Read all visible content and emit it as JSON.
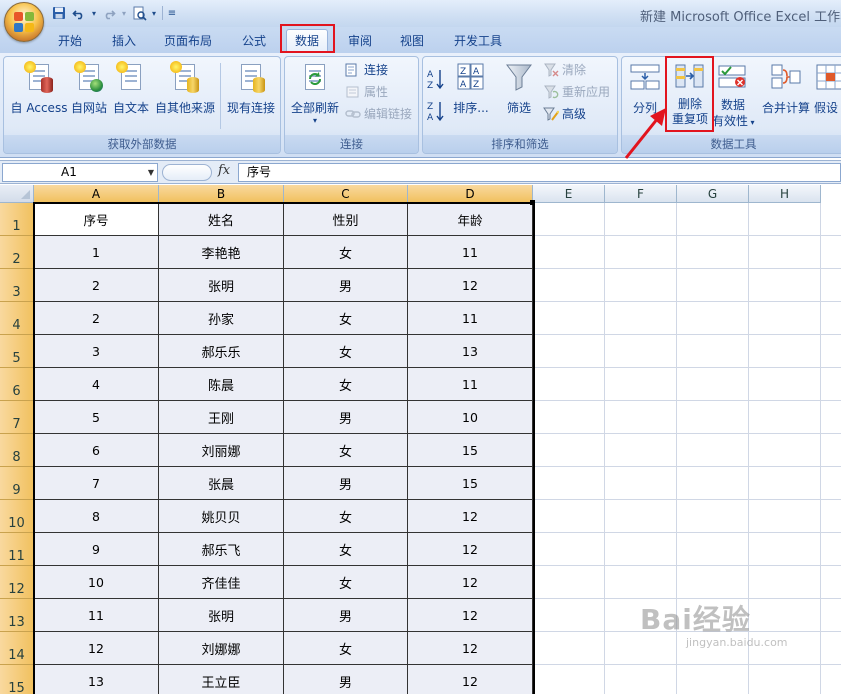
{
  "window": {
    "title": "新建 Microsoft Office Excel 工作表.x"
  },
  "quick_access": {
    "icons": [
      "save-icon",
      "undo-icon",
      "redo-icon",
      "print-preview-icon",
      "customize-qat-icon"
    ]
  },
  "tabs": [
    {
      "label": "开始"
    },
    {
      "label": "插入"
    },
    {
      "label": "页面布局"
    },
    {
      "label": "公式"
    },
    {
      "label": "数据",
      "active": true
    },
    {
      "label": "审阅"
    },
    {
      "label": "视图"
    },
    {
      "label": "开发工具"
    }
  ],
  "ribbon": {
    "external": {
      "label": "获取外部数据",
      "access": "自 Access",
      "web": "自网站",
      "text": "自文本",
      "other": "自其他来源",
      "existing": "现有连接"
    },
    "connections": {
      "label": "连接",
      "refresh_all": "全部刷新",
      "connections": "连接",
      "properties": "属性",
      "edit_links": "编辑链接"
    },
    "sort_filter": {
      "label": "排序和筛选",
      "sort": "排序...",
      "filter": "筛选",
      "clear": "清除",
      "reapply": "重新应用",
      "advanced": "高级"
    },
    "data_tools": {
      "label": "数据工具",
      "split": "分列",
      "remove_dup_1": "删除",
      "remove_dup_2": "重复项",
      "validation_1": "数据",
      "validation_2": "有效性",
      "consolidate": "合并计算",
      "whatif": "假设"
    }
  },
  "formula_bar": {
    "cell_ref": "A1",
    "fx": "fx",
    "value": "序号"
  },
  "sheet": {
    "columns": [
      "A",
      "B",
      "C",
      "D",
      "E",
      "F",
      "G",
      "H"
    ],
    "rows": [
      [
        "序号",
        "姓名",
        "性别",
        "年龄"
      ],
      [
        "1",
        "李艳艳",
        "女",
        "11"
      ],
      [
        "2",
        "张明",
        "男",
        "12"
      ],
      [
        "2",
        "孙家",
        "女",
        "11"
      ],
      [
        "3",
        "郝乐乐",
        "女",
        "13"
      ],
      [
        "4",
        "陈晨",
        "女",
        "11"
      ],
      [
        "5",
        "王刚",
        "男",
        "10"
      ],
      [
        "6",
        "刘丽娜",
        "女",
        "15"
      ],
      [
        "7",
        "张晨",
        "男",
        "15"
      ],
      [
        "8",
        "姚贝贝",
        "女",
        "12"
      ],
      [
        "9",
        "郝乐飞",
        "女",
        "12"
      ],
      [
        "10",
        "齐佳佳",
        "女",
        "12"
      ],
      [
        "11",
        "张明",
        "男",
        "12"
      ],
      [
        "12",
        "刘娜娜",
        "女",
        "12"
      ],
      [
        "13",
        "王立臣",
        "男",
        "12"
      ]
    ],
    "row_numbers": [
      "1",
      "2",
      "3",
      "4",
      "5",
      "6",
      "7",
      "8",
      "9",
      "10",
      "11",
      "12",
      "13",
      "14",
      "15"
    ]
  },
  "watermark": {
    "brand": "Bai经验",
    "url": "jingyan.baidu.com"
  },
  "colors": {
    "highlight": "#e2141e",
    "ribbon_text": "#15428b",
    "data_fill": "#eceef6"
  }
}
